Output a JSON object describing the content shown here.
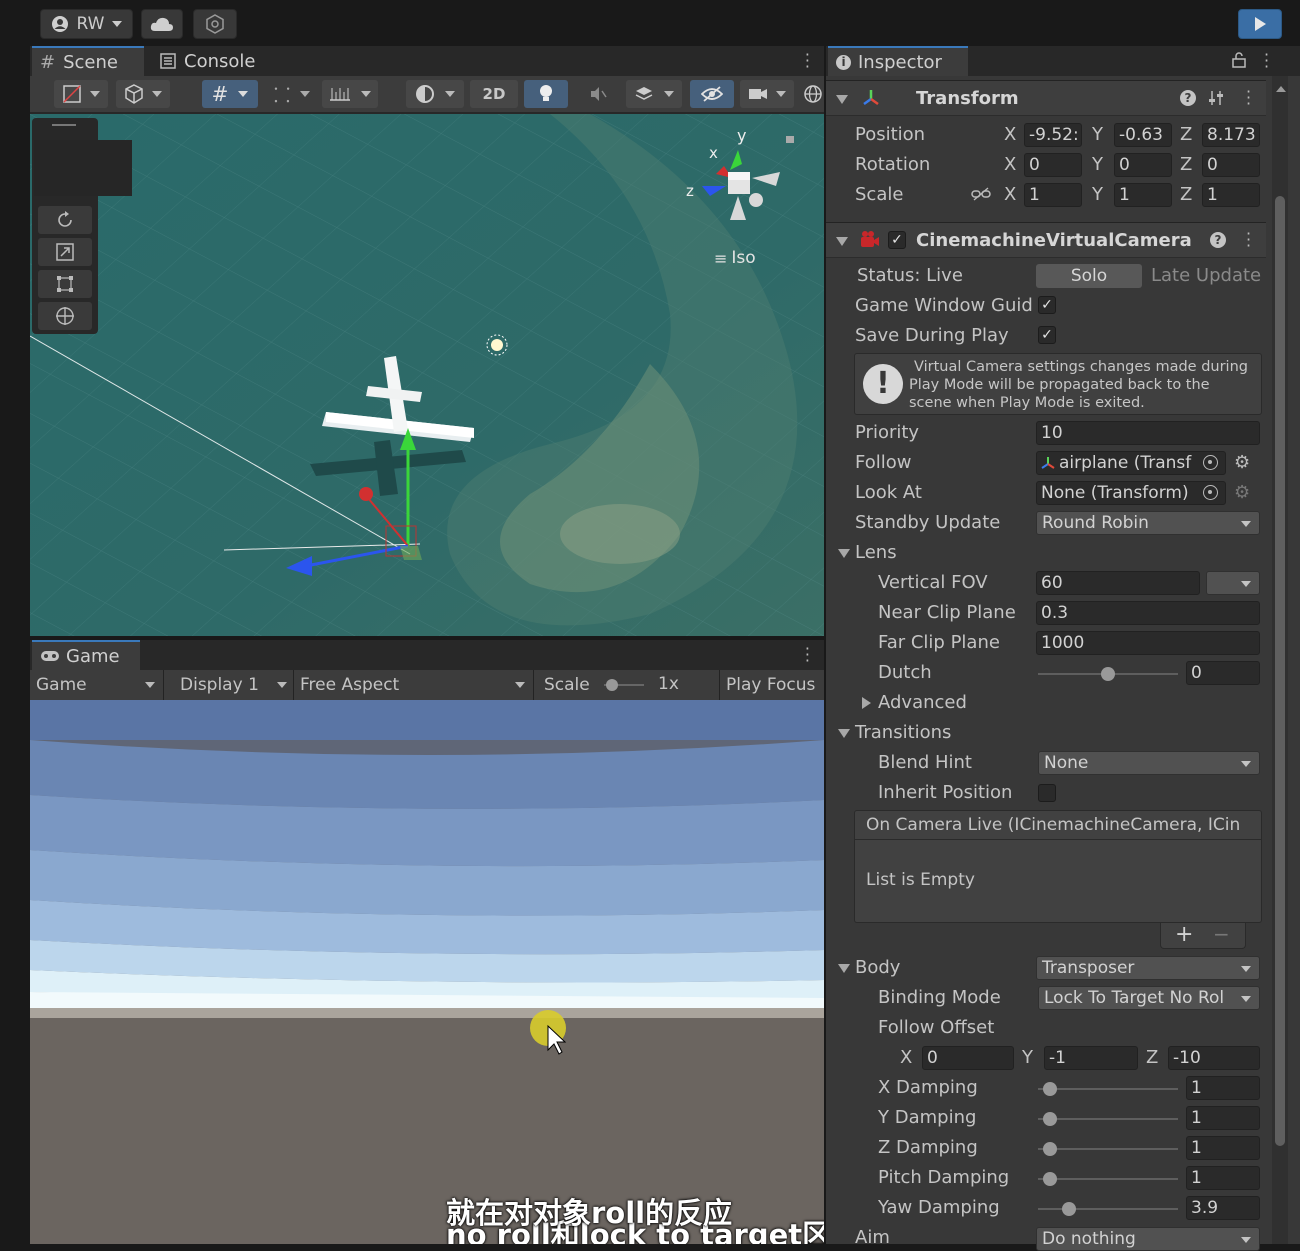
{
  "toolbar": {
    "account_label": "RW"
  },
  "scene": {
    "tab_label": "Scene",
    "console_tab_label": "Console",
    "mode_2d_label": "2D",
    "projection_label": "Iso",
    "axis_x": "x",
    "axis_y": "y",
    "axis_z": "z"
  },
  "game": {
    "tab_label": "Game",
    "view_dropdown": "Game",
    "display_dropdown": "Display 1",
    "aspect_dropdown": "Free Aspect",
    "scale_label": "Scale",
    "scale_value": "1x",
    "play_focus_label": "Play Focus"
  },
  "subtitle": {
    "line1": "no roll和lock to target区别",
    "line2": "就在对对象roll的反应"
  },
  "inspector": {
    "tab_label": "Inspector",
    "transform": {
      "title": "Transform",
      "position_label": "Position",
      "rotation_label": "Rotation",
      "scale_label": "Scale",
      "x": "X",
      "y": "Y",
      "z": "Z",
      "position": [
        "-9.52:",
        "-0.63",
        "8.173"
      ],
      "rotation": [
        "0",
        "0",
        "0"
      ],
      "scale": [
        "1",
        "1",
        "1"
      ]
    },
    "vcam": {
      "title": "CinemachineVirtualCamera",
      "status_label": "Status: Live",
      "solo_label": "Solo",
      "late_update_label": "Late Update",
      "game_window_guides_label": "Game Window Guide",
      "save_during_play_label": "Save During Play",
      "help_text_1": "Virtual Camera settings changes made during",
      "help_text_2": "Play Mode will be propagated back to the",
      "help_text_3": "scene when Play Mode is exited.",
      "priority_label": "Priority",
      "priority_value": "10",
      "follow_label": "Follow",
      "follow_value": "airplane (Transf",
      "look_at_label": "Look At",
      "look_at_value": "None (Transform)",
      "standby_update_label": "Standby Update",
      "standby_update_value": "Round Robin",
      "lens_label": "Lens",
      "vertical_fov_label": "Vertical FOV",
      "vertical_fov_value": "60",
      "near_clip_label": "Near Clip Plane",
      "near_clip_value": "0.3",
      "far_clip_label": "Far Clip Plane",
      "far_clip_value": "1000",
      "dutch_label": "Dutch",
      "dutch_value": "0",
      "dutch_level": 0.5,
      "advanced_label": "Advanced",
      "transitions_label": "Transitions",
      "blend_hint_label": "Blend Hint",
      "blend_hint_value": "None",
      "inherit_position_label": "Inherit Position",
      "event_header": "On Camera Live (ICinemachineCamera, ICin",
      "list_empty_label": "List is Empty",
      "add_label": "+",
      "remove_label": "−",
      "body_label": "Body",
      "body_value": "Transposer",
      "binding_mode_label": "Binding Mode",
      "binding_mode_value": "Lock To Target No Rol",
      "follow_offset_label": "Follow Offset",
      "follow_offset": [
        "0",
        "-1",
        "-10"
      ],
      "x_damping_label": "X Damping",
      "x_damping_value": "1",
      "y_damping_label": "Y Damping",
      "y_damping_value": "1",
      "z_damping_label": "Z Damping",
      "z_damping_value": "1",
      "pitch_damping_label": "Pitch Damping",
      "pitch_damping_value": "1",
      "yaw_damping_label": "Yaw Damping",
      "yaw_damping_value": "3.9",
      "aim_label": "Aim",
      "aim_value": "Do nothing"
    }
  }
}
